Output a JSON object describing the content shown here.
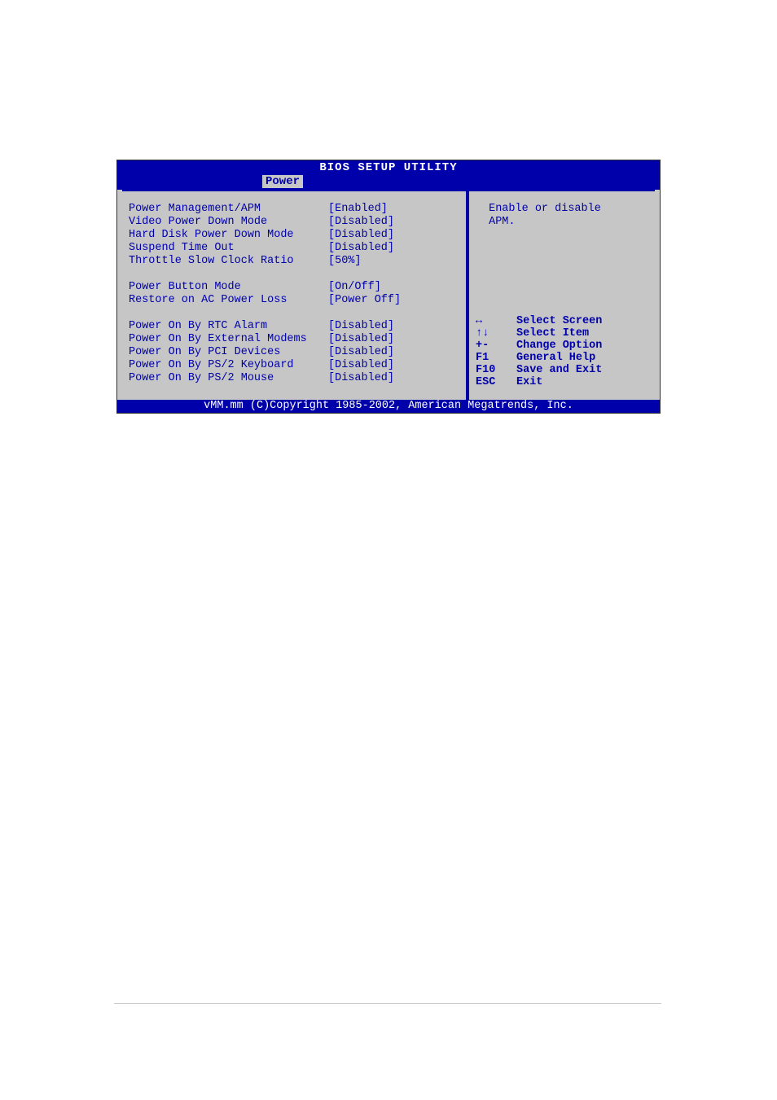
{
  "title": "BIOS SETUP UTILITY",
  "tab": "Power",
  "settings": {
    "group1": [
      {
        "label": "Power Management/APM",
        "value": "[Enabled]"
      },
      {
        "label": "Video Power Down Mode",
        "value": "[Disabled]"
      },
      {
        "label": "Hard Disk Power Down Mode",
        "value": "[Disabled]"
      },
      {
        "label": "Suspend Time Out",
        "value": "[Disabled]"
      },
      {
        "label": "Throttle Slow Clock Ratio",
        "value": "[50%]"
      }
    ],
    "group2": [
      {
        "label": "Power Button Mode",
        "value": "[On/Off]"
      },
      {
        "label": "Restore on AC Power Loss",
        "value": "[Power Off]"
      }
    ],
    "group3": [
      {
        "label": "Power On By RTC Alarm",
        "value": "[Disabled]"
      },
      {
        "label": "Power On By External Modems",
        "value": "[Disabled]"
      },
      {
        "label": "Power On By PCI Devices",
        "value": "[Disabled]"
      },
      {
        "label": "Power On By PS/2 Keyboard",
        "value": "[Disabled]"
      },
      {
        "label": "Power On By PS/2 Mouse",
        "value": "[Disabled]"
      }
    ]
  },
  "help": {
    "text": " Enable or disable\n APM."
  },
  "nav": [
    {
      "key": "↔",
      "desc": "Select Screen"
    },
    {
      "key": "↑↓",
      "desc": "Select Item"
    },
    {
      "key": "+-",
      "desc": "Change Option"
    },
    {
      "key": "F1",
      "desc": "General Help"
    },
    {
      "key": "F10",
      "desc": "Save and Exit"
    },
    {
      "key": "ESC",
      "desc": "Exit"
    }
  ],
  "footer": "vMM.mm (C)Copyright 1985-2002, American Megatrends, Inc."
}
